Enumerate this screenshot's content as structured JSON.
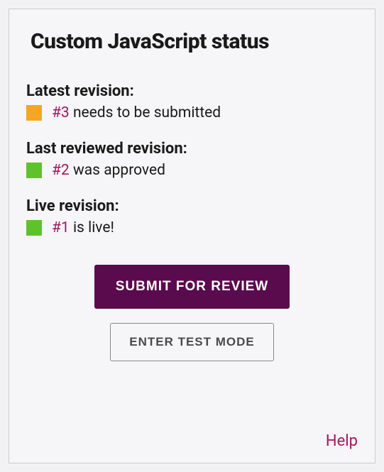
{
  "panel": {
    "title": "Custom JavaScript status"
  },
  "revisions": {
    "latest": {
      "label": "Latest revision:",
      "number": "#3",
      "status_text": " needs to be submitted",
      "status_color": "#f5a623"
    },
    "last_reviewed": {
      "label": "Last reviewed revision:",
      "number": "#2",
      "status_text": " was approved",
      "status_color": "#5fc22a"
    },
    "live": {
      "label": "Live revision:",
      "number": "#1",
      "status_text": " is live!",
      "status_color": "#5fc22a"
    }
  },
  "actions": {
    "submit_label": "SUBMIT FOR REVIEW",
    "test_mode_label": "ENTER TEST MODE"
  },
  "footer": {
    "help_label": "Help"
  }
}
